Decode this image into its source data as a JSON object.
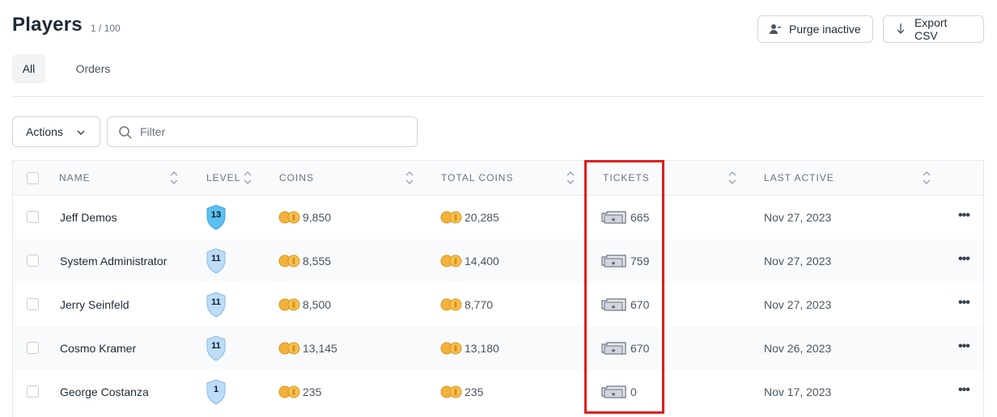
{
  "header": {
    "title": "Players",
    "count": "1 / 100",
    "purge_label": "Purge inactive",
    "export_label": "Export CSV"
  },
  "tabs": [
    {
      "label": "All",
      "active": true
    },
    {
      "label": "Orders",
      "active": false
    }
  ],
  "toolbar": {
    "actions_label": "Actions",
    "filter_placeholder": "Filter"
  },
  "table": {
    "columns": [
      "NAME",
      "LEVEL",
      "COINS",
      "TOTAL COINS",
      "TICKETS",
      "LAST ACTIVE"
    ],
    "rows": [
      {
        "name": "Jeff Demos",
        "level": "13",
        "coins": "9,850",
        "total_coins": "20,285",
        "tickets": "665",
        "last_active": "Nov 27, 2023"
      },
      {
        "name": "System Administrator",
        "level": "11",
        "coins": "8,555",
        "total_coins": "14,400",
        "tickets": "759",
        "last_active": "Nov 27, 2023"
      },
      {
        "name": "Jerry Seinfeld",
        "level": "11",
        "coins": "8,500",
        "total_coins": "8,770",
        "tickets": "670",
        "last_active": "Nov 27, 2023"
      },
      {
        "name": "Cosmo Kramer",
        "level": "11",
        "coins": "13,145",
        "total_coins": "13,180",
        "tickets": "670",
        "last_active": "Nov 26, 2023"
      },
      {
        "name": "George Costanza",
        "level": "1",
        "coins": "235",
        "total_coins": "235",
        "tickets": "0",
        "last_active": "Nov 17, 2023"
      }
    ],
    "row_menu_glyph": "•••"
  },
  "colors": {
    "highlight": "#e11d1d",
    "shield_level_13": "#5bc0f0",
    "shield_default": "#bcdcf7",
    "coin": "#f2b33d"
  },
  "icons": [
    "user-minus-icon",
    "download-arrow-icon",
    "chevron-down-icon",
    "search-icon",
    "sort-icon",
    "level-shield-icon",
    "coin-icon",
    "ticket-icon",
    "more-options-icon"
  ]
}
